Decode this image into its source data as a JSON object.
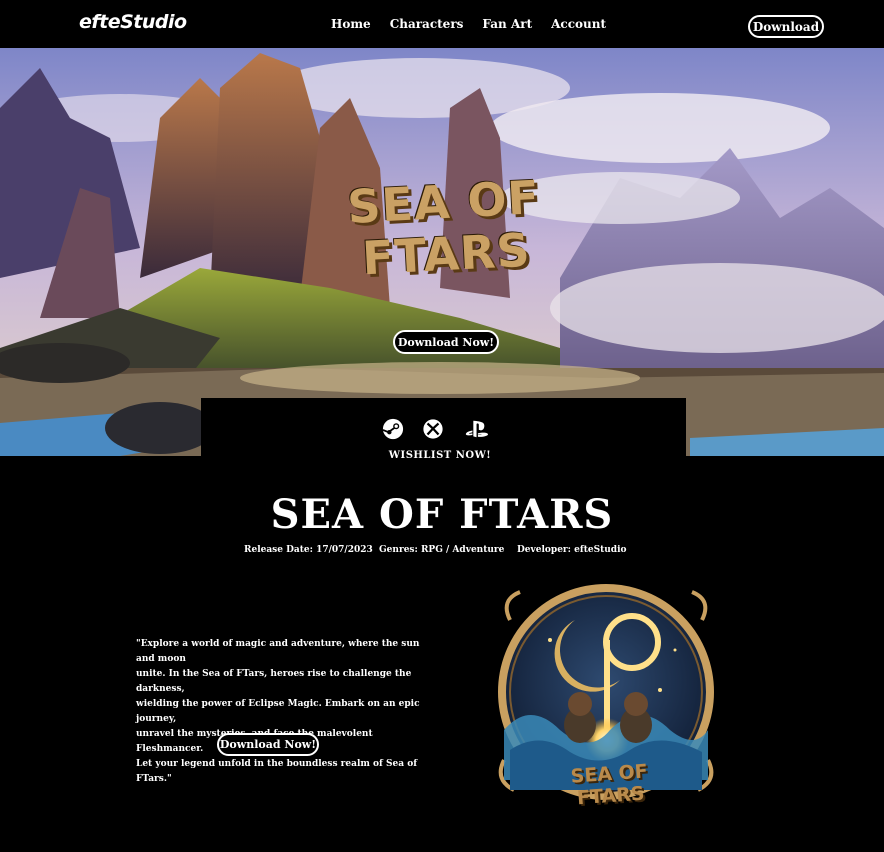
{
  "nav": {
    "logo": "efteStudio",
    "links": [
      "Home",
      "Characters",
      "Fan Art",
      "Account"
    ],
    "download_label": "Download"
  },
  "hero": {
    "logo_line1": "SEA OF",
    "logo_line2": "FTARS",
    "download_label": "Download Now!"
  },
  "wishlist": {
    "platforms": [
      "steam-icon",
      "xbox-icon",
      "playstation-icon"
    ],
    "label": "WISHLIST NOW!"
  },
  "game": {
    "title": "SEA OF FTARS",
    "release": "Release Date: 17/07/2023",
    "genres": "Genres: RPG / Adventure",
    "developer": "Developer: efteStudio"
  },
  "description": {
    "lines": [
      "\"Explore a world of magic and adventure, where the sun and moon",
      "unite. In the Sea of FTars, heroes rise to challenge the darkness,",
      "wielding the power of Eclipse Magic. Embark on an epic journey,",
      "unravel the mysteries, and face the malevolent Fleshmancer.",
      "Let your legend unfold in the boundless realm of Sea of FTars.\""
    ],
    "download_label": "Download Now!"
  },
  "emblem": {
    "line1": "SEA OF",
    "line2": "FTARS"
  },
  "colors": {
    "background": "#000000",
    "accent_gold": "#caa164"
  }
}
